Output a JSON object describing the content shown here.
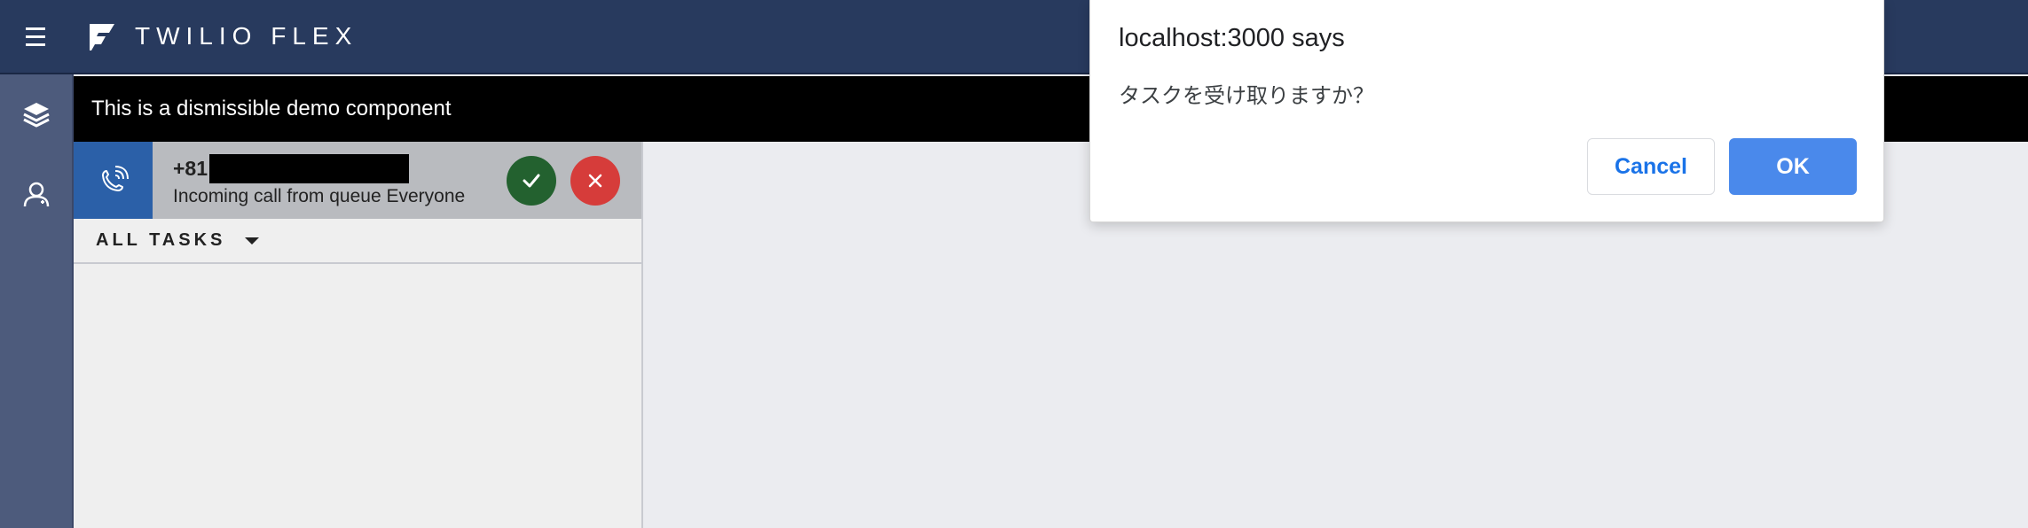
{
  "header": {
    "title": "TWILIO FLEX",
    "menu_icon": "hamburger-menu-icon",
    "logo_icon": "twilio-flex-logo"
  },
  "sidenav": {
    "items": [
      {
        "icon": "layers-icon",
        "active": true
      },
      {
        "icon": "agents-icon",
        "active": false
      }
    ]
  },
  "banner": {
    "text": "This is a dismissible demo component"
  },
  "task": {
    "number_prefix": "+81",
    "number_redacted": true,
    "subtitle": "Incoming call from queue Everyone",
    "icon": "phone-ringing-icon",
    "accept_icon": "checkmark-icon",
    "reject_icon": "close-icon"
  },
  "tasks_filter": {
    "label": "ALL TASKS"
  },
  "dialog": {
    "title": "localhost:3000 says",
    "message": "タスクを受け取りますか？",
    "cancel_label": "Cancel",
    "ok_label": "OK"
  },
  "colors": {
    "header_bg": "#283a5e",
    "sidenav_bg": "#4d5b7c",
    "task_icon_bg": "#2b60a8",
    "accept_bg": "#23612f",
    "reject_bg": "#d63c3a",
    "ok_button_bg": "#4a89eb",
    "cancel_text": "#1a73e8"
  }
}
